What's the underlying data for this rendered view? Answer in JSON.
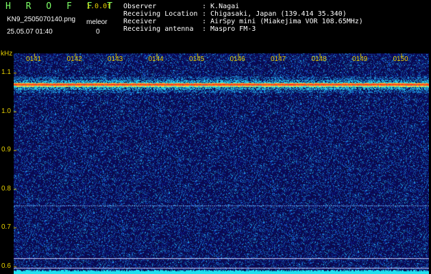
{
  "header": {
    "title": "H R O F F T",
    "version": "1.0.0f",
    "filename": "KN9_2505070140.png",
    "meleor_label": "meleor",
    "timestamp": "25.05.07 01:40",
    "meleor_value": "0"
  },
  "info": [
    {
      "key": "Observer",
      "value": ": K.Nagai"
    },
    {
      "key": "Receiving Location",
      "value": ": Chigasaki, Japan (139.414 35.340)"
    },
    {
      "key": "Receiver",
      "value": ": AirSpy mini (Miakejima VOR 108.65MHz)"
    },
    {
      "key": "Receiving antenna",
      "value": ": Maspro FM-3"
    }
  ],
  "colors": {
    "label": "#e6d000",
    "title": "#7cff66",
    "background_plot": "#0a0a55",
    "signal": "#ff3030"
  },
  "chart_data": {
    "type": "heatmap",
    "y_unit": "kHz",
    "y_ticks": [
      "1.1",
      "1.0",
      "0.9",
      "0.8",
      "0.7",
      "0.6"
    ],
    "x_ticks": [
      "0141",
      "0142",
      "0143",
      "0144",
      "0145",
      "0146",
      "0147",
      "0148",
      "0149",
      "0150"
    ],
    "ylim": [
      0.58,
      1.15
    ],
    "signal_freq_khz": 1.07,
    "weak_line_khz": 0.757,
    "reference_lines_khz": [
      0.621,
      0.596
    ]
  }
}
